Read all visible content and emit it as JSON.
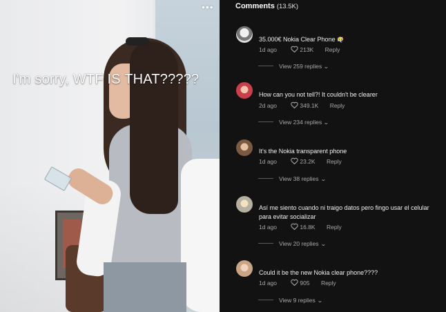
{
  "video": {
    "overlay_text": "I'm sorry, WTF IS THAT?????",
    "more_icon": "more-dots-icon"
  },
  "comments_panel": {
    "title": "Comments",
    "count": "(13.5K)"
  },
  "comments": [
    {
      "text": "35.000€ Nokia Clear Phone",
      "emoji": "😶‍🌫️",
      "time": "1d ago",
      "likes": "213K",
      "reply_label": "Reply",
      "view_replies": "View 259 replies",
      "avatar_color": "#cfcfcf"
    },
    {
      "text": "How can you not tell?! It couldn't be clearer",
      "time": "2d ago",
      "likes": "349.1K",
      "reply_label": "Reply",
      "view_replies": "View 234 replies",
      "avatar_color": "#c9404a"
    },
    {
      "text": "It's the Nokia transparent phone",
      "time": "1d ago",
      "likes": "23.2K",
      "reply_label": "Reply",
      "view_replies": "View 38 replies",
      "avatar_color": "#b08a6a"
    },
    {
      "text": "Así me siento cuando ni traigo datos pero fingo usar el celular para evitar socializar",
      "time": "1d ago",
      "likes": "16.8K",
      "reply_label": "Reply",
      "view_replies": "View 20 replies",
      "avatar_color": "#c8b070"
    },
    {
      "text": "Could it be the new Nokia clear phone????",
      "time": "1d ago",
      "likes": "905",
      "reply_label": "Reply",
      "view_replies": "View 9 replies",
      "avatar_color": "#d6b9a3"
    }
  ]
}
